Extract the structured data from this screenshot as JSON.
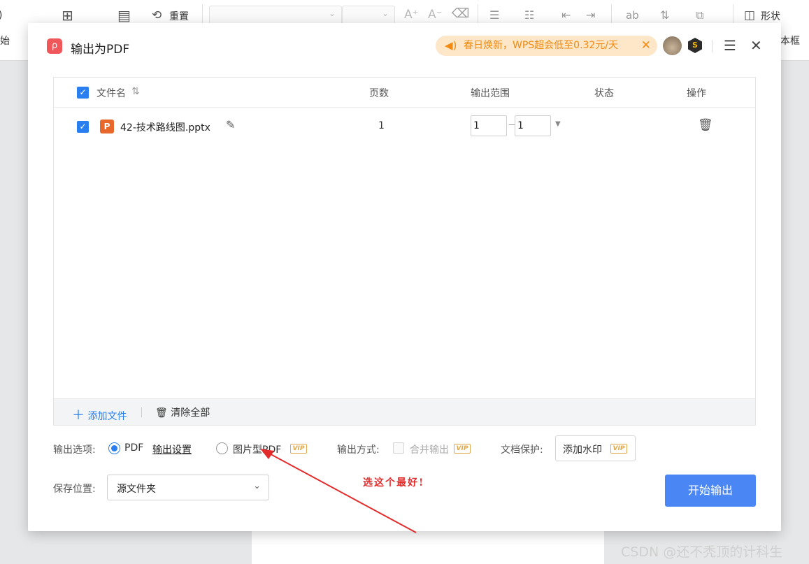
{
  "background_toolbar": {
    "reset_label": "重置",
    "shape_label": "形状",
    "left_cut_text": "始",
    "right_cut_text": "本框"
  },
  "dialog": {
    "title": "输出为PDF",
    "promo_text": "春日焕新，WPS超会低至0.32元/天",
    "menu_icon": "hamburger-icon",
    "close_icon": "close-icon"
  },
  "table": {
    "headers": {
      "filename": "文件名",
      "pages": "页数",
      "range": "输出范围",
      "status": "状态",
      "action": "操作"
    },
    "rows": [
      {
        "checked": true,
        "filename": "42-技术路线图.pptx",
        "pages": "1",
        "range_from": "1",
        "range_to": "1",
        "status": ""
      }
    ],
    "footer": {
      "add_file": "添加文件",
      "clear_all": "清除全部"
    }
  },
  "options": {
    "output_options_label": "输出选项:",
    "pdf_label": "PDF",
    "pdf_selected": true,
    "output_settings_link": "输出设置",
    "image_pdf_label": "图片型PDF",
    "vip_tag": "VIP",
    "output_mode_label": "输出方式:",
    "merge_output_label": "合并输出",
    "doc_protect_label": "文档保护:",
    "add_watermark_label": "添加水印"
  },
  "save": {
    "label": "保存位置:",
    "value": "源文件夹"
  },
  "start_button": "开始输出",
  "annotation": {
    "text": "选这个最好!",
    "color": "#e32b2b"
  },
  "watermark": "CSDN @还不秃顶的计科生",
  "colors": {
    "accent": "#2a7ff0",
    "primary_button": "#4b86f5",
    "promo_bg": "#fde7c8",
    "promo_text": "#f08a12"
  }
}
